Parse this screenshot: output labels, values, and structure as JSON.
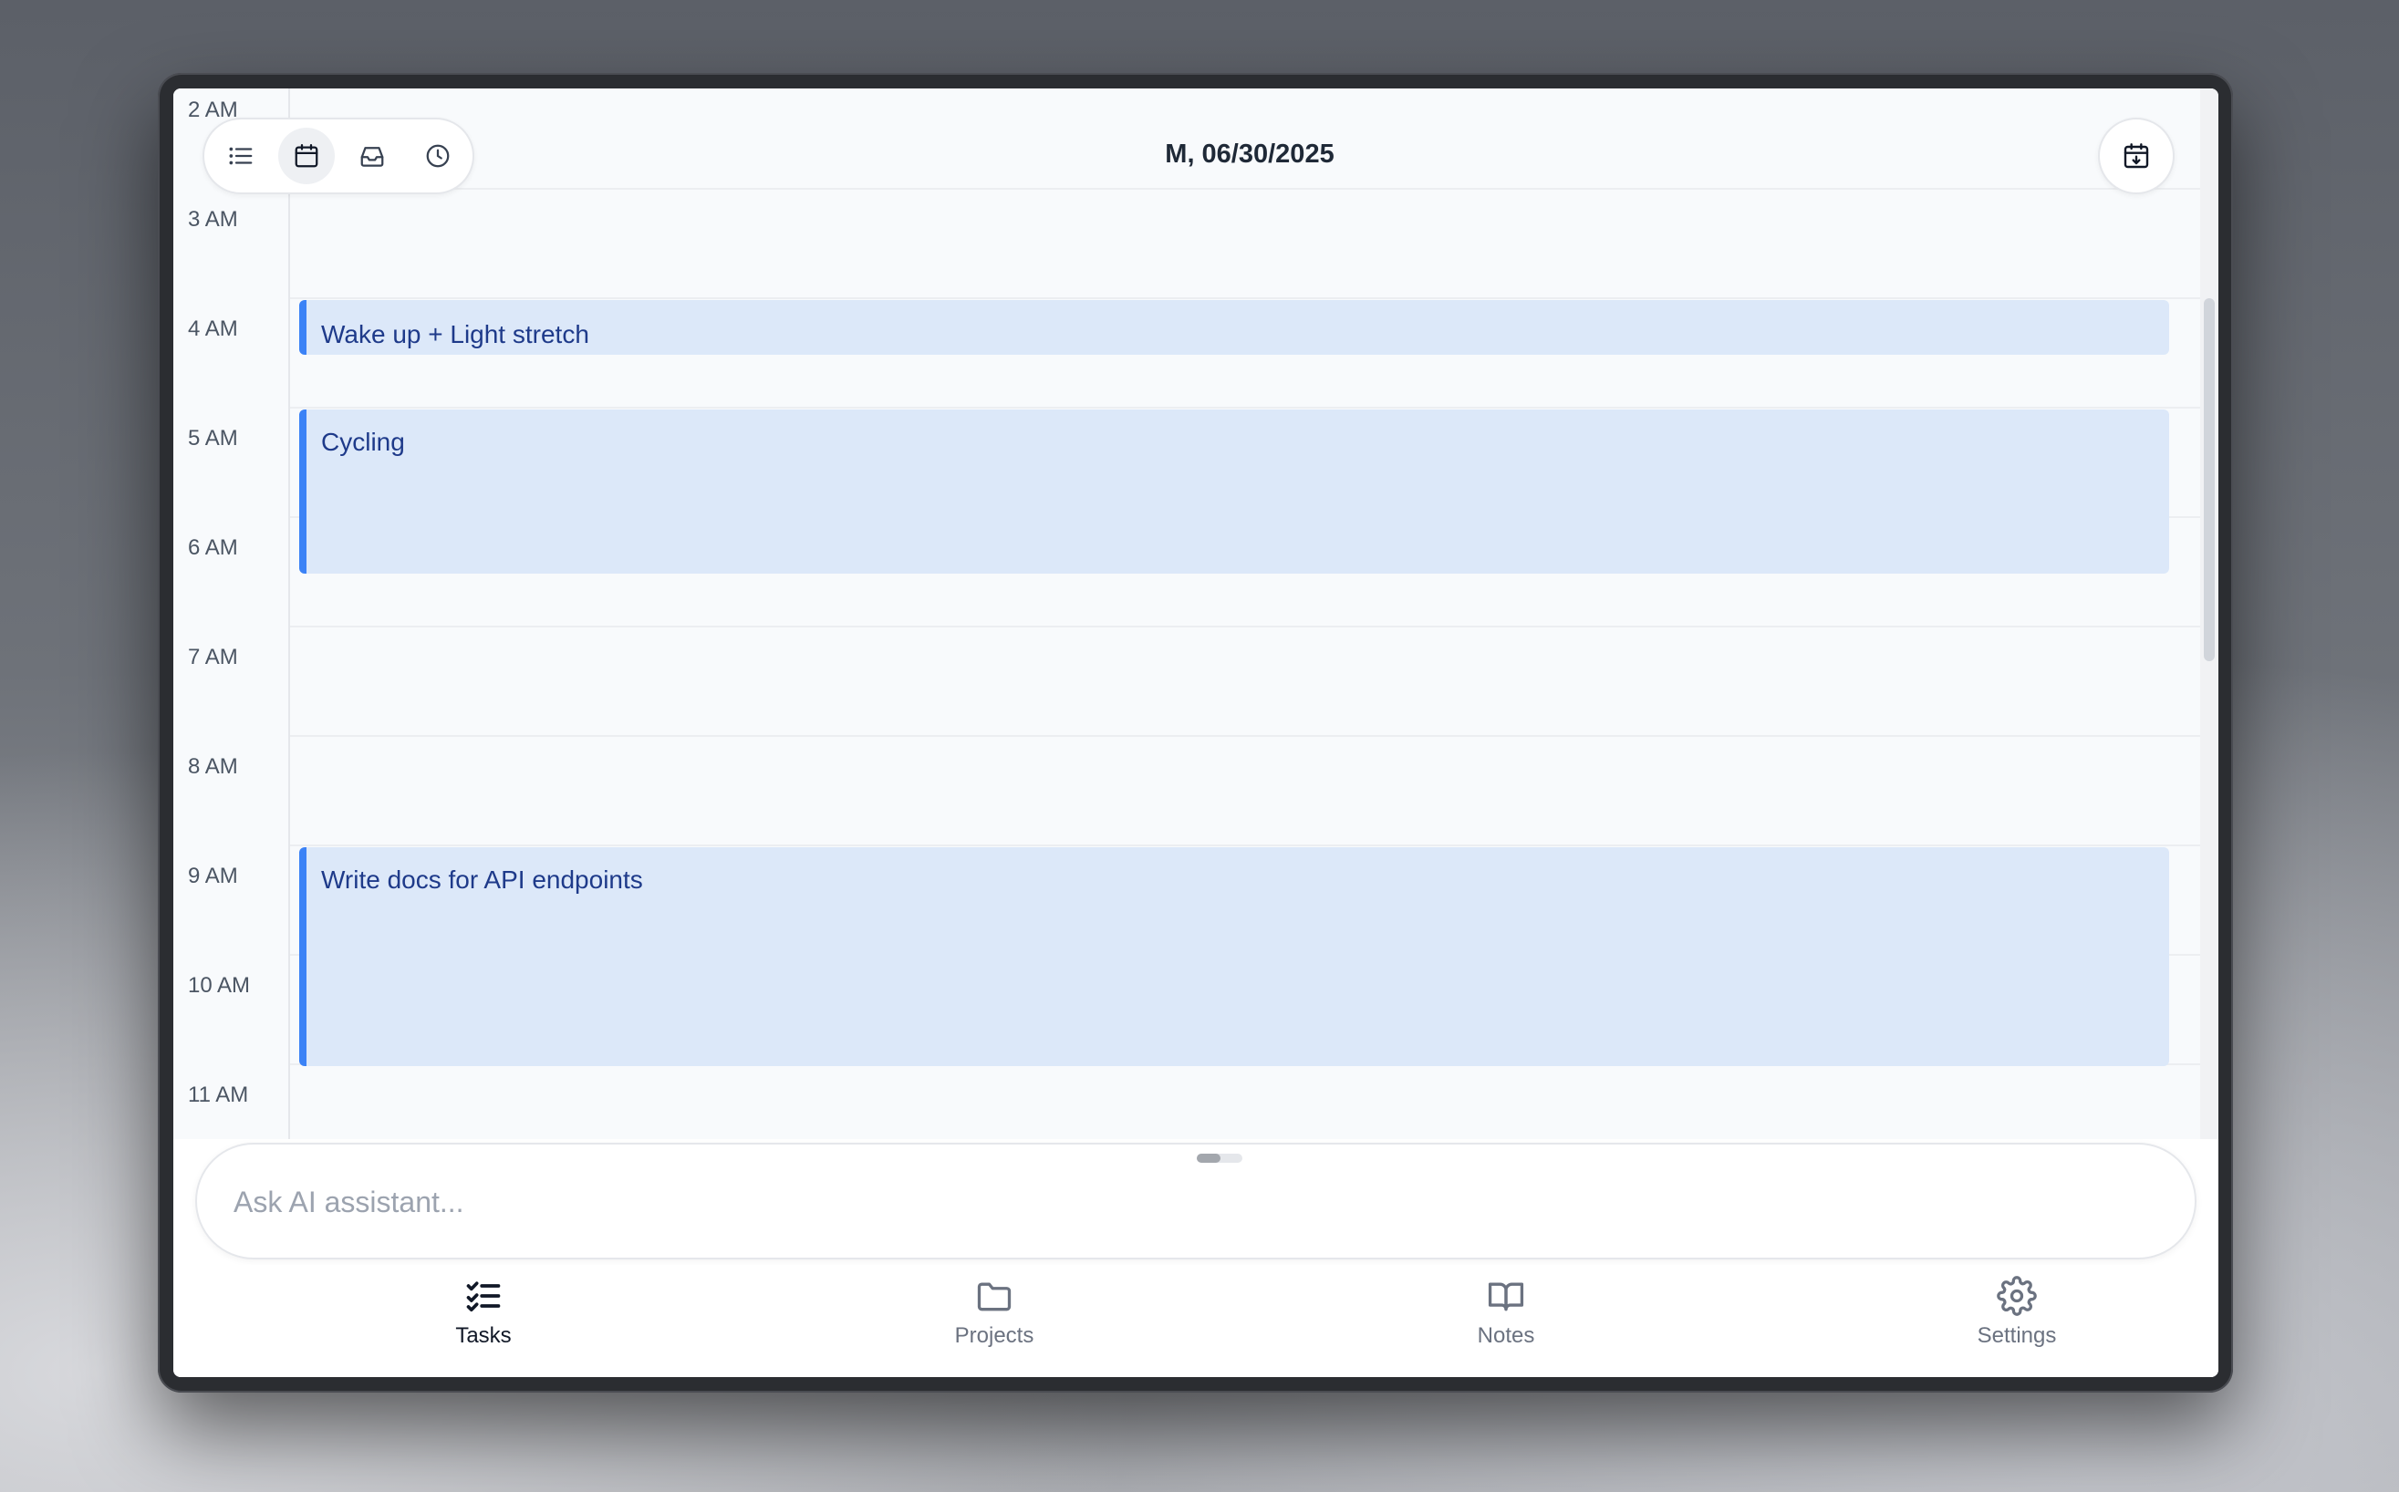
{
  "header": {
    "date": "M, 06/30/2025",
    "views": [
      {
        "icon": "list-icon",
        "active": false
      },
      {
        "icon": "calendar-icon",
        "active": true
      },
      {
        "icon": "inbox-icon",
        "active": false
      },
      {
        "icon": "clock-icon",
        "active": false
      }
    ],
    "today_button_icon": "calendar-arrow-down-icon"
  },
  "timeline": {
    "hours": [
      "2 AM",
      "3 AM",
      "4 AM",
      "5 AM",
      "6 AM",
      "7 AM",
      "8 AM",
      "9 AM",
      "10 AM",
      "11 AM"
    ],
    "events": [
      {
        "title": "Wake up + Light stretch"
      },
      {
        "title": "Cycling"
      },
      {
        "title": "Write docs for API endpoints"
      }
    ]
  },
  "assistant": {
    "placeholder": "Ask AI assistant..."
  },
  "bottom_nav": {
    "items": [
      {
        "label": "Tasks",
        "icon": "tasks-checklist-icon",
        "active": true
      },
      {
        "label": "Projects",
        "icon": "folder-icon",
        "active": false
      },
      {
        "label": "Notes",
        "icon": "book-open-icon",
        "active": false
      },
      {
        "label": "Settings",
        "icon": "gear-icon",
        "active": false
      }
    ]
  },
  "colors": {
    "event_bg": "#dce8f9",
    "event_accent": "#3b82f6",
    "event_text": "#1e3a8a"
  }
}
